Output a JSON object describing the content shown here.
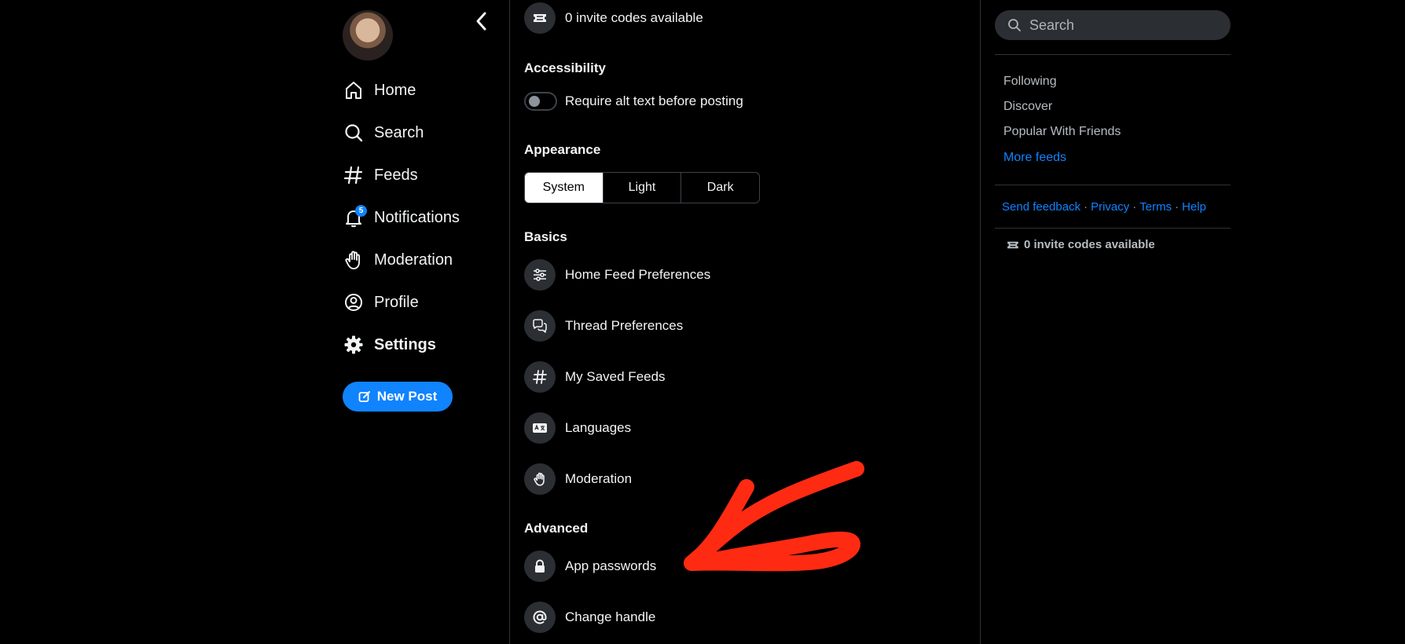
{
  "nav": {
    "items": [
      {
        "label": "Home",
        "icon": "home-icon"
      },
      {
        "label": "Search",
        "icon": "search-icon"
      },
      {
        "label": "Feeds",
        "icon": "hashtag-icon"
      },
      {
        "label": "Notifications",
        "icon": "bell-icon",
        "badge": "5"
      },
      {
        "label": "Moderation",
        "icon": "hand-icon"
      },
      {
        "label": "Profile",
        "icon": "user-circle-icon"
      },
      {
        "label": "Settings",
        "icon": "gear-icon",
        "active": true
      }
    ],
    "new_post_label": "New Post"
  },
  "main": {
    "invite_codes_label": "0 invite codes available",
    "accessibility": {
      "title": "Accessibility",
      "toggle_label": "Require alt text before posting",
      "toggle_on": false
    },
    "appearance": {
      "title": "Appearance",
      "options": [
        "System",
        "Light",
        "Dark"
      ],
      "selected": "System"
    },
    "basics": {
      "title": "Basics",
      "items": [
        {
          "label": "Home Feed Preferences",
          "icon": "sliders-icon"
        },
        {
          "label": "Thread Preferences",
          "icon": "chat-bubbles-icon"
        },
        {
          "label": "My Saved Feeds",
          "icon": "hashtag-icon"
        },
        {
          "label": "Languages",
          "icon": "language-card-icon"
        },
        {
          "label": "Moderation",
          "icon": "hand-icon"
        }
      ]
    },
    "advanced": {
      "title": "Advanced",
      "items": [
        {
          "label": "App passwords",
          "icon": "lock-icon"
        },
        {
          "label": "Change handle",
          "icon": "at-sign-icon"
        }
      ]
    }
  },
  "right": {
    "search_placeholder": "Search",
    "feeds": [
      "Following",
      "Discover",
      "Popular With Friends"
    ],
    "more_feeds_label": "More feeds",
    "footer_links": [
      "Send feedback",
      "Privacy",
      "Terms",
      "Help"
    ],
    "invite_codes_label": "0 invite codes available"
  },
  "colors": {
    "accent": "#1083fe",
    "annotation_arrow": "#ff2a12",
    "background": "#000000"
  }
}
